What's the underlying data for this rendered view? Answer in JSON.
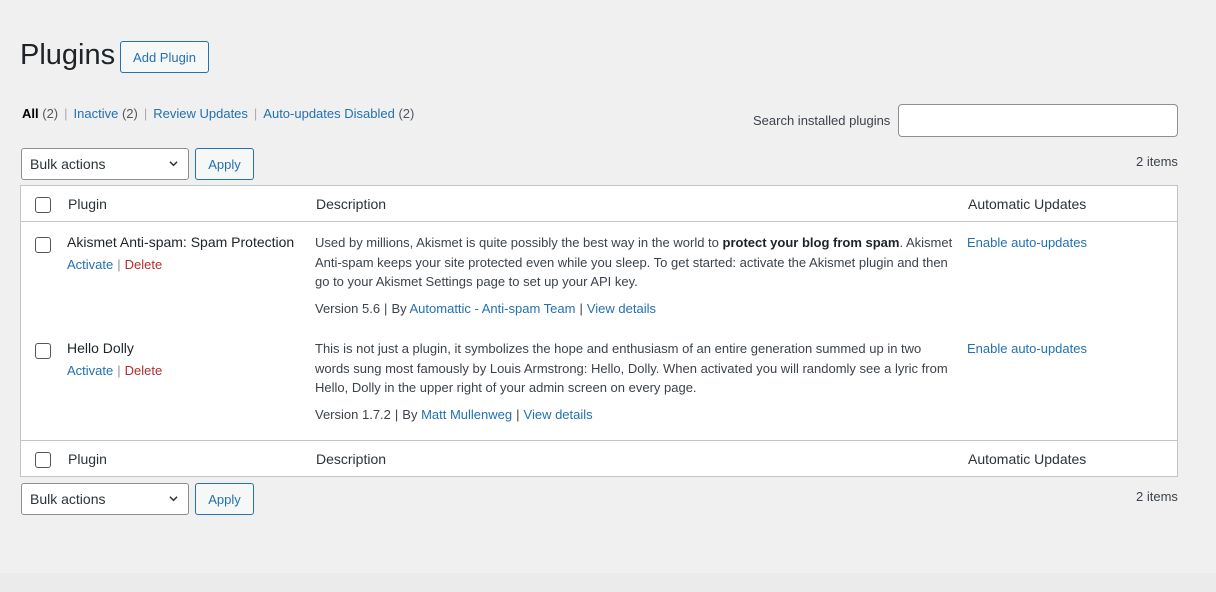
{
  "header": {
    "title": "Plugins",
    "add_button": "Add Plugin"
  },
  "filters": [
    {
      "label": "All",
      "count": "(2)",
      "current": true
    },
    {
      "label": "Inactive",
      "count": "(2)"
    },
    {
      "label": "Review Updates",
      "count": ""
    },
    {
      "label": "Auto-updates Disabled",
      "count": "(2)"
    }
  ],
  "search": {
    "label": "Search installed plugins",
    "value": ""
  },
  "toolbar": {
    "bulk_label": "Bulk actions",
    "apply_label": "Apply",
    "items_count": "2 items"
  },
  "table": {
    "columns": [
      "Plugin",
      "Description",
      "Automatic Updates"
    ],
    "rows": [
      {
        "name": "Akismet Anti-spam: Spam Protection",
        "activate": "Activate",
        "delete": "Delete",
        "desc_pre": "Used by millions, Akismet is quite possibly the best way in the world to ",
        "desc_bold": "protect your blog from spam",
        "desc_post": ". Akismet Anti-spam keeps your site protected even while you sleep. To get started: activate the Akismet plugin and then go to your Akismet Settings page to set up your API key.",
        "version": "Version 5.6",
        "by": "By",
        "author": "Automattic - Anti-spam Team",
        "view_details": "View details",
        "auto": "Enable auto-updates"
      },
      {
        "name": "Hello Dolly",
        "activate": "Activate",
        "delete": "Delete",
        "desc_pre": "This is not just a plugin, it symbolizes the hope and enthusiasm of an entire generation summed up in two words sung most famously by Louis Armstrong: Hello, Dolly. When activated you will randomly see a lyric from Hello, Dolly in the upper right of your admin screen on every page.",
        "desc_bold": "",
        "desc_post": "",
        "version": "Version 1.7.2",
        "by": "By",
        "author": "Matt Mullenweg",
        "view_details": "View details",
        "auto": "Enable auto-updates"
      }
    ]
  },
  "colors": {
    "link": "#2271b1",
    "delete": "#b32d2e",
    "background": "#f0f0f1"
  }
}
